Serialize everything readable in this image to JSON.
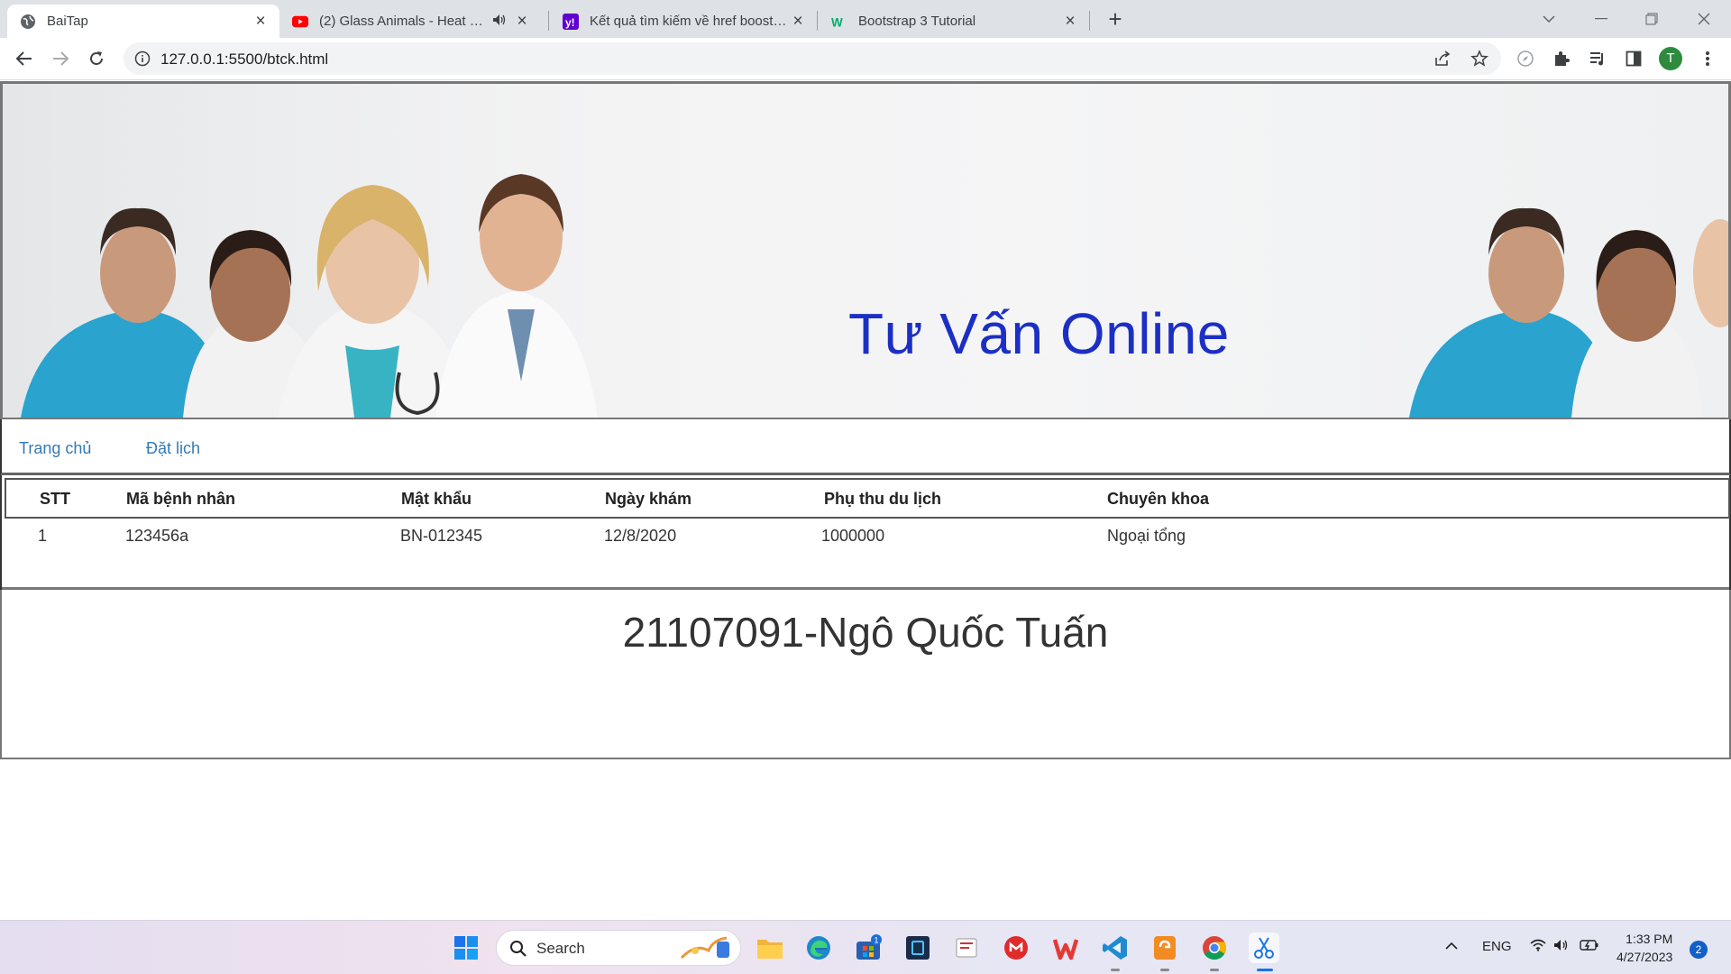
{
  "browser": {
    "tabs": [
      {
        "title": "BaiTap",
        "active": true,
        "icon": "globe-icon"
      },
      {
        "title": "(2) Glass Animals - Heat Waves",
        "active": false,
        "icon": "youtube-icon",
        "audio": true
      },
      {
        "title": "Kết quả tìm kiếm về href boostrap",
        "active": false,
        "icon": "yahoo-icon"
      },
      {
        "title": "Bootstrap 3 Tutorial",
        "active": false,
        "icon": "w3schools-icon"
      }
    ],
    "url": "127.0.0.1:5500/btck.html",
    "profile_initial": "T"
  },
  "page": {
    "banner": {
      "title": "Tư Vấn Online"
    },
    "menu": {
      "items": [
        {
          "label": "Trang chủ"
        },
        {
          "label": "Đặt lịch"
        }
      ]
    },
    "table": {
      "headers": [
        "STT",
        "Mã bệnh nhân",
        "Mật khẩu",
        "Ngày khám",
        "Phụ thu du lịch",
        "Chuyên khoa"
      ],
      "rows": [
        [
          "1",
          "123456a",
          "BN-012345",
          "12/8/2020",
          "1000000",
          "Ngoại tổng"
        ]
      ]
    },
    "footer": {
      "text": "21107091-Ngô Quốc Tuấn"
    }
  },
  "taskbar": {
    "search_label": "Search",
    "store_badge": "1",
    "language": "ENG",
    "time": "1:33 PM",
    "date": "4/27/2023",
    "notifications": "2"
  },
  "colors": {
    "link": "#337ab7",
    "banner_title": "#1c2fc4",
    "tabstrip_bg": "#dee1e6"
  }
}
